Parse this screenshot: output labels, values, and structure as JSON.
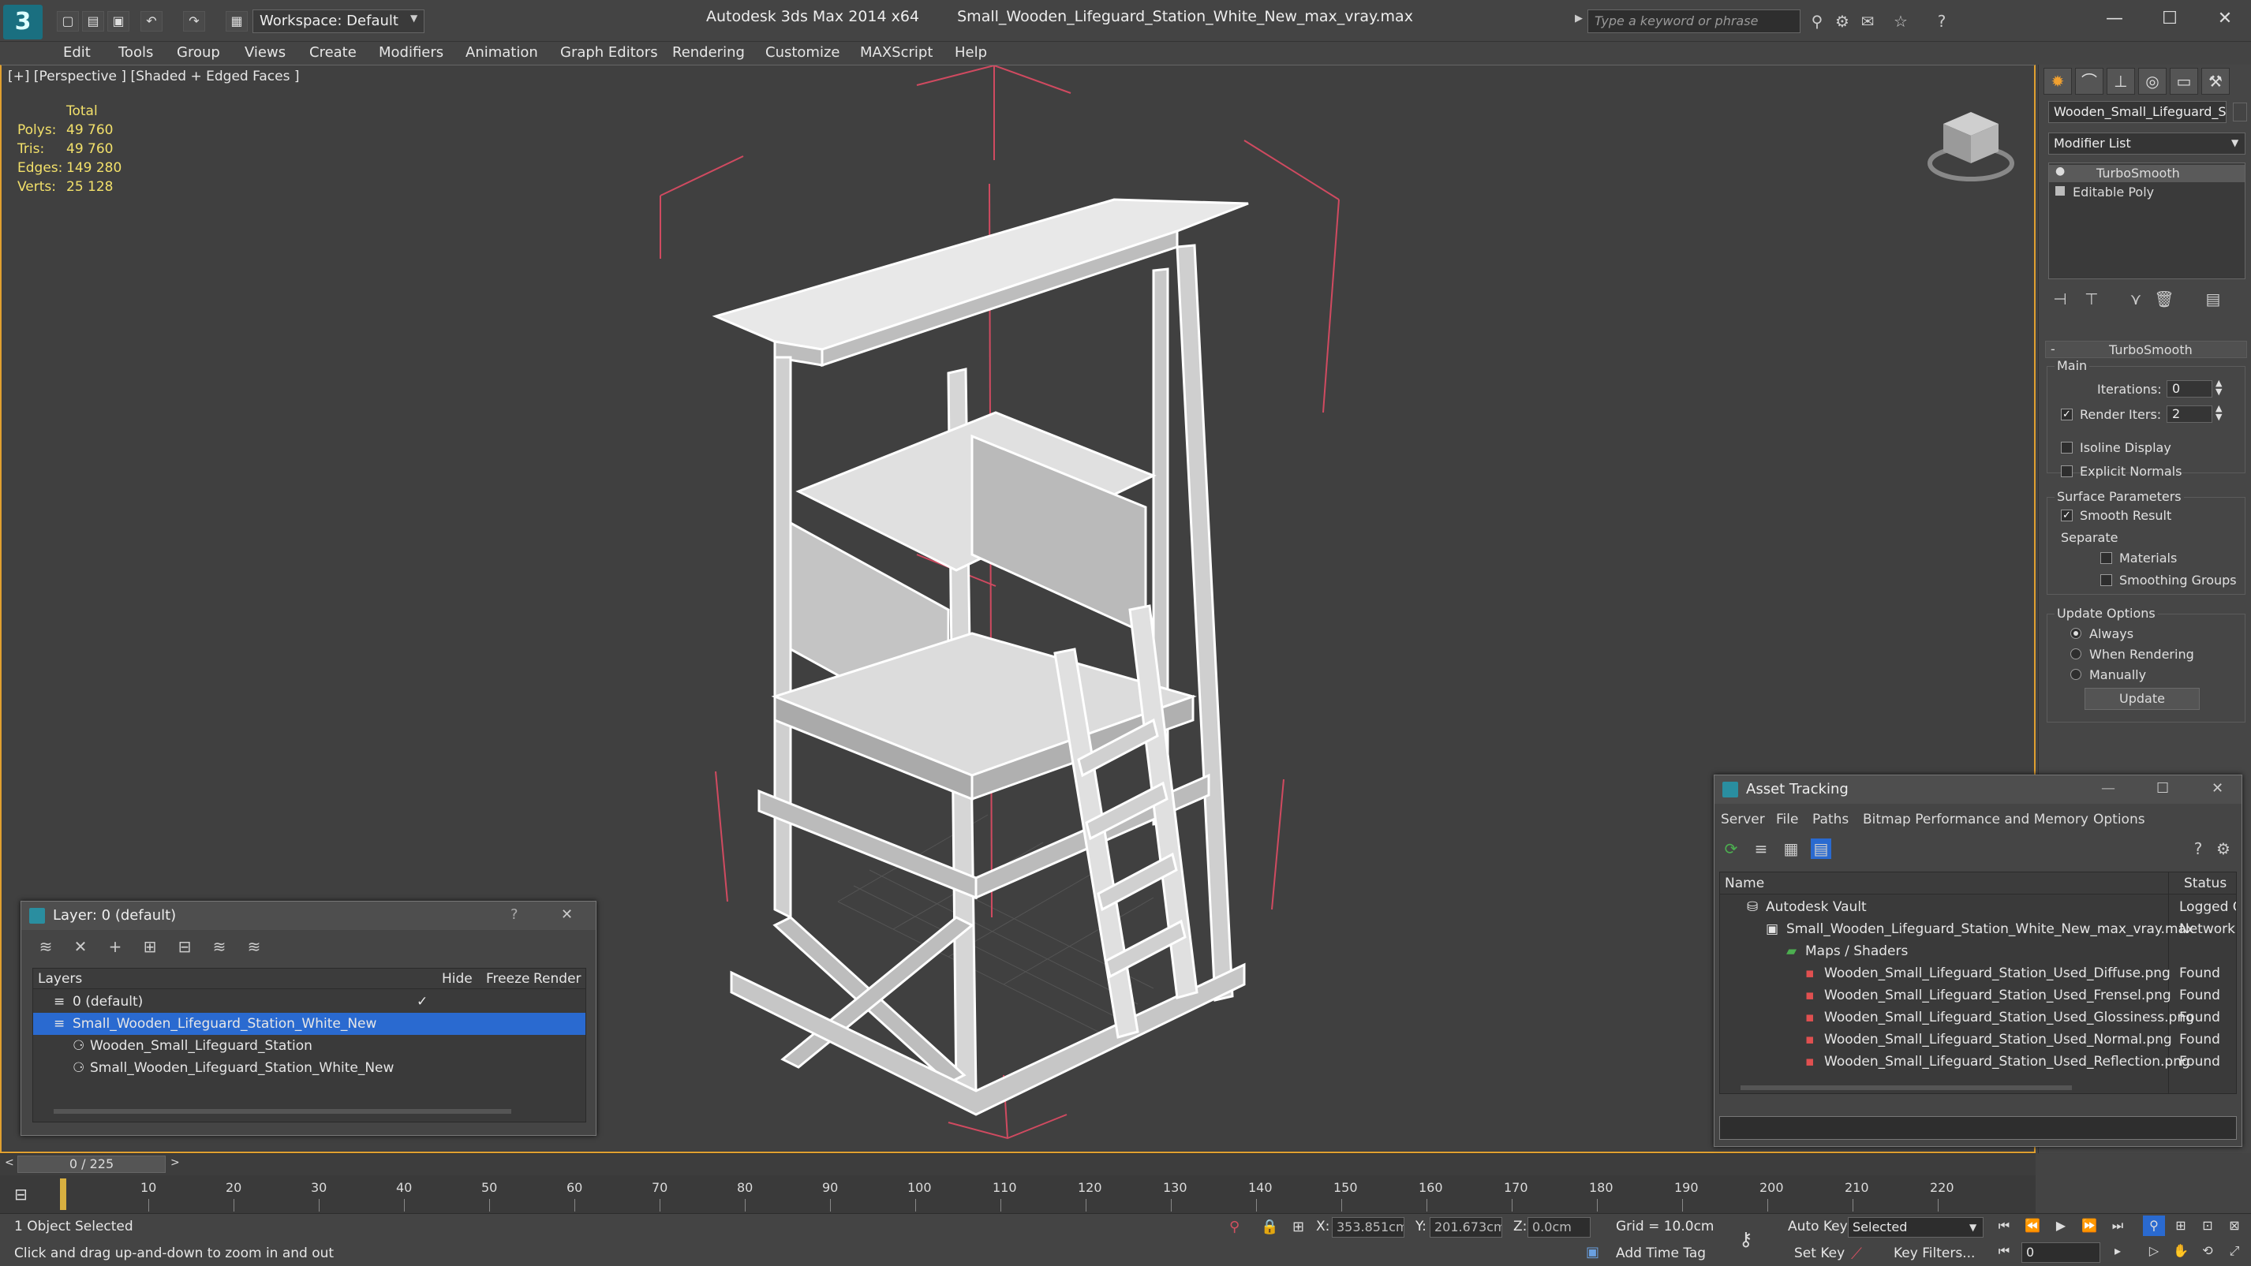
{
  "titlebar": {
    "workspace": "Workspace: Default",
    "app_name": "Autodesk 3ds Max  2014 x64",
    "file_name": "Small_Wooden_Lifeguard_Station_White_New_max_vray.max",
    "search_placeholder": "Type a keyword or phrase"
  },
  "menu": {
    "items": [
      "Edit",
      "Tools",
      "Group",
      "Views",
      "Create",
      "Modifiers",
      "Animation",
      "Graph Editors",
      "Rendering",
      "Customize",
      "MAXScript",
      "Help"
    ]
  },
  "viewport": {
    "label": "[+] [Perspective ] [Shaded + Edged Faces ]",
    "stats": {
      "total_label": "Total",
      "polys_label": "Polys:",
      "polys": "49 760",
      "tris_label": "Tris:",
      "tris": "49 760",
      "edges_label": "Edges:",
      "edges": "149 280",
      "verts_label": "Verts:",
      "verts": "25 128"
    }
  },
  "command_panel": {
    "object_name": "Wooden_Small_Lifeguard_Sta",
    "modifier_list": "Modifier List",
    "stack": [
      "TurboSmooth",
      "Editable Poly"
    ],
    "rollout_title": "TurboSmooth",
    "main_label": "Main",
    "iterations_label": "Iterations:",
    "iterations": "0",
    "render_iters_label": "Render Iters:",
    "render_iters": "2",
    "isoline_label": "Isoline Display",
    "explicit_normals_label": "Explicit Normals",
    "surface_params_label": "Surface Parameters",
    "smooth_result_label": "Smooth Result",
    "separate_label": "Separate",
    "materials_label": "Materials",
    "smoothing_groups_label": "Smoothing Groups",
    "update_options_label": "Update Options",
    "always_label": "Always",
    "when_rendering_label": "When Rendering",
    "manually_label": "Manually",
    "update_button": "Update"
  },
  "layer_window": {
    "title": "Layer: 0 (default)",
    "help": "?",
    "columns": [
      "Layers",
      "Hide",
      "Freeze",
      "Render"
    ],
    "rows": [
      "0 (default)",
      "Small_Wooden_Lifeguard_Station_White_New",
      "Wooden_Small_Lifeguard_Station",
      "Small_Wooden_Lifeguard_Station_White_New"
    ]
  },
  "asset_window": {
    "title": "Asset Tracking",
    "menus": [
      "Server",
      "File",
      "Paths",
      "Bitmap Performance and Memory",
      "Options"
    ],
    "columns": [
      "Name",
      "Status"
    ],
    "rows": [
      {
        "name": "Autodesk Vault",
        "status": "Logged O"
      },
      {
        "name": "Small_Wooden_Lifeguard_Station_White_New_max_vray.max",
        "status": "Network P"
      },
      {
        "name": "Maps / Shaders",
        "status": ""
      },
      {
        "name": "Wooden_Small_Lifeguard_Station_Used_Diffuse.png",
        "status": "Found"
      },
      {
        "name": "Wooden_Small_Lifeguard_Station_Used_Frensel.png",
        "status": "Found"
      },
      {
        "name": "Wooden_Small_Lifeguard_Station_Used_Glossiness.png",
        "status": "Found"
      },
      {
        "name": "Wooden_Small_Lifeguard_Station_Used_Normal.png",
        "status": "Found"
      },
      {
        "name": "Wooden_Small_Lifeguard_Station_Used_Reflection.png",
        "status": "Found"
      }
    ]
  },
  "timeline": {
    "frame": "0 / 225",
    "ticks": [
      "10",
      "20",
      "30",
      "40",
      "50",
      "60",
      "70",
      "80",
      "90",
      "100",
      "110",
      "120",
      "130",
      "140",
      "150",
      "160",
      "170",
      "180",
      "190",
      "200",
      "210",
      "220"
    ]
  },
  "statusbar": {
    "selection": "1 Object Selected",
    "hint": "Click and drag up-and-down to zoom in and out",
    "x_label": "X:",
    "x": "353.851cm",
    "y_label": "Y:",
    "y": "201.673cm",
    "z_label": "Z:",
    "z": "0.0cm",
    "grid": "Grid = 10.0cm",
    "auto_key": "Auto Key",
    "selected": "Selected",
    "set_key": "Set Key",
    "key_filters": "Key Filters...",
    "add_time_tag": "Add Time Tag",
    "frame_field": "0"
  }
}
